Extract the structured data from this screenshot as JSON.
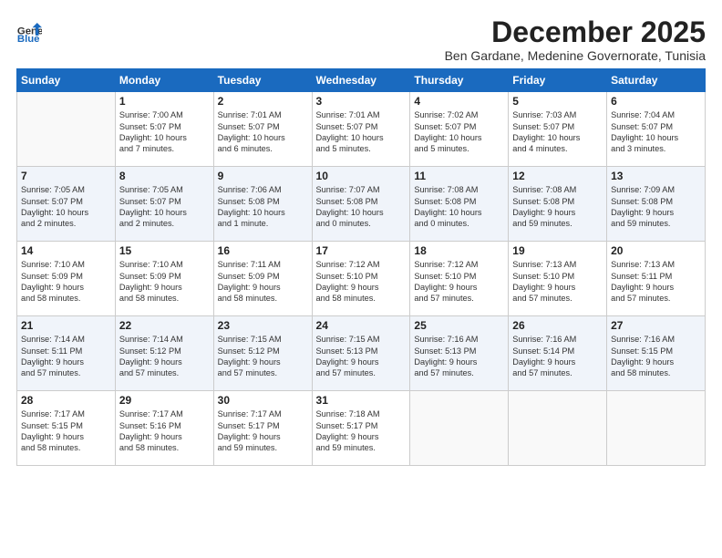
{
  "logo": {
    "general": "General",
    "blue": "Blue"
  },
  "title": "December 2025",
  "location": "Ben Gardane, Medenine Governorate, Tunisia",
  "days_of_week": [
    "Sunday",
    "Monday",
    "Tuesday",
    "Wednesday",
    "Thursday",
    "Friday",
    "Saturday"
  ],
  "weeks": [
    [
      {
        "day": "",
        "info": ""
      },
      {
        "day": "1",
        "info": "Sunrise: 7:00 AM\nSunset: 5:07 PM\nDaylight: 10 hours\nand 7 minutes."
      },
      {
        "day": "2",
        "info": "Sunrise: 7:01 AM\nSunset: 5:07 PM\nDaylight: 10 hours\nand 6 minutes."
      },
      {
        "day": "3",
        "info": "Sunrise: 7:01 AM\nSunset: 5:07 PM\nDaylight: 10 hours\nand 5 minutes."
      },
      {
        "day": "4",
        "info": "Sunrise: 7:02 AM\nSunset: 5:07 PM\nDaylight: 10 hours\nand 5 minutes."
      },
      {
        "day": "5",
        "info": "Sunrise: 7:03 AM\nSunset: 5:07 PM\nDaylight: 10 hours\nand 4 minutes."
      },
      {
        "day": "6",
        "info": "Sunrise: 7:04 AM\nSunset: 5:07 PM\nDaylight: 10 hours\nand 3 minutes."
      }
    ],
    [
      {
        "day": "7",
        "info": "Sunrise: 7:05 AM\nSunset: 5:07 PM\nDaylight: 10 hours\nand 2 minutes."
      },
      {
        "day": "8",
        "info": "Sunrise: 7:05 AM\nSunset: 5:07 PM\nDaylight: 10 hours\nand 2 minutes."
      },
      {
        "day": "9",
        "info": "Sunrise: 7:06 AM\nSunset: 5:08 PM\nDaylight: 10 hours\nand 1 minute."
      },
      {
        "day": "10",
        "info": "Sunrise: 7:07 AM\nSunset: 5:08 PM\nDaylight: 10 hours\nand 0 minutes."
      },
      {
        "day": "11",
        "info": "Sunrise: 7:08 AM\nSunset: 5:08 PM\nDaylight: 10 hours\nand 0 minutes."
      },
      {
        "day": "12",
        "info": "Sunrise: 7:08 AM\nSunset: 5:08 PM\nDaylight: 9 hours\nand 59 minutes."
      },
      {
        "day": "13",
        "info": "Sunrise: 7:09 AM\nSunset: 5:08 PM\nDaylight: 9 hours\nand 59 minutes."
      }
    ],
    [
      {
        "day": "14",
        "info": "Sunrise: 7:10 AM\nSunset: 5:09 PM\nDaylight: 9 hours\nand 58 minutes."
      },
      {
        "day": "15",
        "info": "Sunrise: 7:10 AM\nSunset: 5:09 PM\nDaylight: 9 hours\nand 58 minutes."
      },
      {
        "day": "16",
        "info": "Sunrise: 7:11 AM\nSunset: 5:09 PM\nDaylight: 9 hours\nand 58 minutes."
      },
      {
        "day": "17",
        "info": "Sunrise: 7:12 AM\nSunset: 5:10 PM\nDaylight: 9 hours\nand 58 minutes."
      },
      {
        "day": "18",
        "info": "Sunrise: 7:12 AM\nSunset: 5:10 PM\nDaylight: 9 hours\nand 57 minutes."
      },
      {
        "day": "19",
        "info": "Sunrise: 7:13 AM\nSunset: 5:10 PM\nDaylight: 9 hours\nand 57 minutes."
      },
      {
        "day": "20",
        "info": "Sunrise: 7:13 AM\nSunset: 5:11 PM\nDaylight: 9 hours\nand 57 minutes."
      }
    ],
    [
      {
        "day": "21",
        "info": "Sunrise: 7:14 AM\nSunset: 5:11 PM\nDaylight: 9 hours\nand 57 minutes."
      },
      {
        "day": "22",
        "info": "Sunrise: 7:14 AM\nSunset: 5:12 PM\nDaylight: 9 hours\nand 57 minutes."
      },
      {
        "day": "23",
        "info": "Sunrise: 7:15 AM\nSunset: 5:12 PM\nDaylight: 9 hours\nand 57 minutes."
      },
      {
        "day": "24",
        "info": "Sunrise: 7:15 AM\nSunset: 5:13 PM\nDaylight: 9 hours\nand 57 minutes."
      },
      {
        "day": "25",
        "info": "Sunrise: 7:16 AM\nSunset: 5:13 PM\nDaylight: 9 hours\nand 57 minutes."
      },
      {
        "day": "26",
        "info": "Sunrise: 7:16 AM\nSunset: 5:14 PM\nDaylight: 9 hours\nand 57 minutes."
      },
      {
        "day": "27",
        "info": "Sunrise: 7:16 AM\nSunset: 5:15 PM\nDaylight: 9 hours\nand 58 minutes."
      }
    ],
    [
      {
        "day": "28",
        "info": "Sunrise: 7:17 AM\nSunset: 5:15 PM\nDaylight: 9 hours\nand 58 minutes."
      },
      {
        "day": "29",
        "info": "Sunrise: 7:17 AM\nSunset: 5:16 PM\nDaylight: 9 hours\nand 58 minutes."
      },
      {
        "day": "30",
        "info": "Sunrise: 7:17 AM\nSunset: 5:17 PM\nDaylight: 9 hours\nand 59 minutes."
      },
      {
        "day": "31",
        "info": "Sunrise: 7:18 AM\nSunset: 5:17 PM\nDaylight: 9 hours\nand 59 minutes."
      },
      {
        "day": "",
        "info": ""
      },
      {
        "day": "",
        "info": ""
      },
      {
        "day": "",
        "info": ""
      }
    ]
  ]
}
